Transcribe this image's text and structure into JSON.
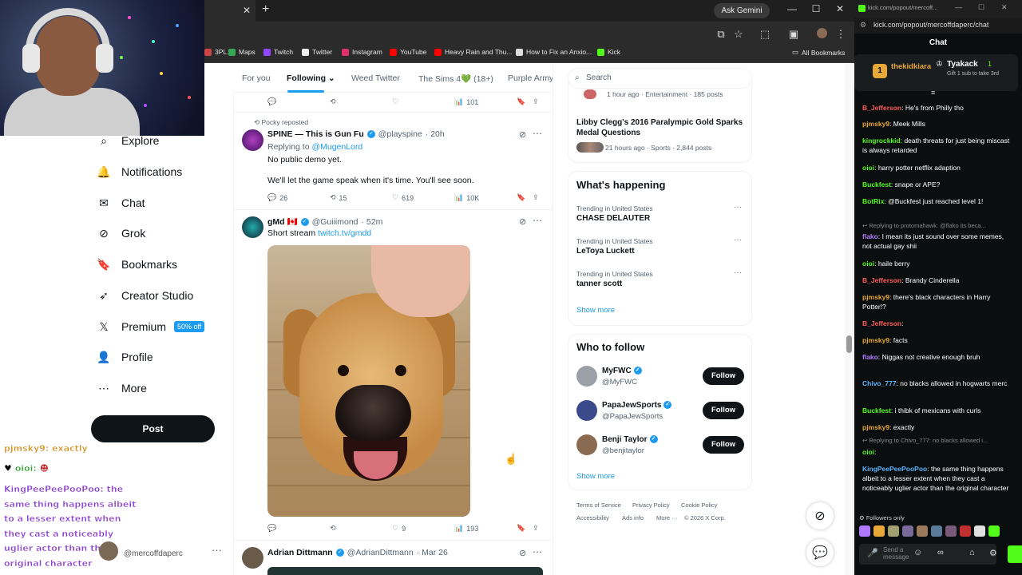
{
  "browser": {
    "tab_close": "✕",
    "new_tab": "+",
    "gemini_label": "Ask Gemini",
    "bookmarks": [
      {
        "label": "3PL...",
        "color": "#c44"
      },
      {
        "label": "Maps",
        "color": "#34a853"
      },
      {
        "label": "Twitch",
        "color": "#9146ff"
      },
      {
        "label": "Twitter",
        "color": "#eee"
      },
      {
        "label": "Instagram",
        "color": "#e1306c"
      },
      {
        "label": "YouTube",
        "color": "#ff0000"
      },
      {
        "label": "Heavy Rain and Thu...",
        "color": "#ff0000"
      },
      {
        "label": "How to Fix an Anxio...",
        "color": "#ddd"
      },
      {
        "label": "Kick",
        "color": "#53fc18"
      }
    ],
    "all_bookmarks": "All Bookmarks"
  },
  "nav": {
    "items": [
      {
        "label": "Explore",
        "icon": "search-icon",
        "glyph": "⌕"
      },
      {
        "label": "Notifications",
        "icon": "bell-icon",
        "glyph": "🔔"
      },
      {
        "label": "Chat",
        "icon": "mail-icon",
        "glyph": "✉"
      },
      {
        "label": "Grok",
        "icon": "grok-icon",
        "glyph": "⊘"
      },
      {
        "label": "Bookmarks",
        "icon": "bookmark-icon",
        "glyph": "🔖"
      },
      {
        "label": "Creator Studio",
        "icon": "rocket-icon",
        "glyph": "➶"
      },
      {
        "label": "Premium",
        "icon": "x-logo-icon",
        "glyph": "𝕏"
      },
      {
        "label": "Profile",
        "icon": "person-icon",
        "glyph": "👤"
      },
      {
        "label": "More",
        "icon": "more-circle-icon",
        "glyph": "⋯"
      }
    ],
    "premium_badge": "50% off",
    "post_button": "Post"
  },
  "overlay_chat": [
    {
      "user": "pjmsky9:",
      "text": " exactly",
      "color": "#d09020"
    },
    {
      "user": "oioi:",
      "text": "",
      "color": "#30a030"
    },
    {
      "user": "KingPeePeePooPoo:",
      "text": " the same thing happens albeit to a lesser extent when they cast a noticeably uglier actor than the original character",
      "color": "#8a40d0"
    }
  ],
  "overlay_user": {
    "handle": "@mercoffdaperc",
    "dots": "···"
  },
  "feed": {
    "tabs": [
      "For you",
      "Following",
      "Weed Twitter",
      "The Sims 4💚 (18+)",
      "Purple Army"
    ],
    "top_actions": {
      "views": "101"
    },
    "tweet1": {
      "repost_label": "Pocky reposted",
      "name": "SPINE — This is Gun Fu",
      "handle": "@playspine",
      "time": "· 20h",
      "replying_prefix": "Replying to",
      "replying_to": "@MugenLord",
      "line1": "No public demo yet.",
      "line2": "We'll let the game speak when it's time. You'll see soon.",
      "replies": "26",
      "reposts": "15",
      "likes": "619",
      "views": "10K"
    },
    "tweet2": {
      "name": "gMd 🇨🇦",
      "handle": "@Guiiimond",
      "time": "· 52m",
      "text_prefix": "Short stream",
      "link": "twitch.tv/gmdd",
      "replies": "",
      "reposts": "",
      "likes": "9",
      "views": "193"
    },
    "tweet3": {
      "name": "Adrian Dittmann",
      "handle": "@AdrianDittmann",
      "time": "· Mar 26"
    }
  },
  "right": {
    "search_placeholder": "Search",
    "news_top": {
      "meta": "1 hour ago · Entertainment · 185 posts"
    },
    "news": {
      "title": "Libby Clegg's 2016 Paralympic Gold Sparks Medal Questions",
      "meta": "21 hours ago · Sports · 2,844 posts"
    },
    "happening_title": "What's happening",
    "trends": [
      {
        "context": "Trending in United States",
        "name": "CHASE DELAUTER"
      },
      {
        "context": "Trending in United States",
        "name": "LeToya Luckett"
      },
      {
        "context": "Trending in United States",
        "name": "tanner scott"
      }
    ],
    "show_more": "Show more",
    "who_title": "Who to follow",
    "follows": [
      {
        "name": "MyFWC",
        "handle": "@MyFWC",
        "avatar_color": "#9aa0a6"
      },
      {
        "name": "PapaJewSports",
        "handle": "@PapaJewSports",
        "avatar_color": "#3b4a8a"
      },
      {
        "name": "Benji Taylor",
        "handle": "@benjitaylor",
        "avatar_color": "#8a6a50"
      }
    ],
    "follow_label": "Follow",
    "footer": [
      "Terms of Service",
      "Privacy Policy",
      "Cookie Policy",
      "Accessibility",
      "Ads info",
      "More ···",
      "© 2026 X Corp."
    ]
  },
  "kick": {
    "tab_url": "kick.com/popout/mercoff...",
    "address": "kick.com/popout/mercoffdaperc/chat",
    "chat_title": "Chat",
    "pinned": {
      "user": "thekidkiara",
      "second_user": "Tyakack",
      "gift_text": "Gift 1 sub to take 3rd",
      "rank1": "1",
      "rank2": "1"
    },
    "messages": [
      {
        "user": "B_Jefferson",
        "text": ": He's from Philly tho",
        "color": "#ff5a5a"
      },
      {
        "user": "pjmsky9",
        "text": ": Meek Mills",
        "color": "#e8a838"
      },
      {
        "user": "kingrockkid",
        "text": ": death threats for just being miscast is always retarded",
        "color": "#53fc18"
      },
      {
        "user": "oioi",
        "text": ": harry potter netflix adaption",
        "color": "#53fc18"
      },
      {
        "user": "Buckfest",
        "text": ": snape or APE?",
        "color": "#53fc18"
      },
      {
        "user": "BotRix",
        "text": ": @Buckfest just reached level 1!",
        "color": "#53fc18"
      },
      {
        "user": "flako",
        "text": ": I mean its just sound over some memes, not actual gay shii",
        "color": "#b07aff"
      },
      {
        "user": "oioi",
        "text": ": haile berry",
        "color": "#53fc18"
      },
      {
        "user": "B_Jefferson",
        "text": ": Brandy Cinderella",
        "color": "#ff5a5a"
      },
      {
        "user": "pjmsky9",
        "text": ": there's black characters in Harry Potter!?",
        "color": "#e8a838"
      },
      {
        "user": "B_Jefferson",
        "text": ":",
        "color": "#ff5a5a"
      },
      {
        "user": "pjmsky9",
        "text": ": facts",
        "color": "#e8a838"
      },
      {
        "user": "flako",
        "text": ": Niggas not creative enough bruh",
        "color": "#b07aff"
      },
      {
        "user": "Chivo_777",
        "text": ": no blacks allowed in hogwarts merc",
        "color": "#5ab4ff"
      },
      {
        "user": "Buckfest",
        "text": ": i thibk of mexicans with curls",
        "color": "#53fc18"
      },
      {
        "user": "pjmsky9",
        "text": ": exactly",
        "color": "#e8a838"
      },
      {
        "user": "oioi",
        "text": ":",
        "color": "#53fc18"
      },
      {
        "user": "KingPeePeePooPoo",
        "text": ": the same thing happens albeit to a lesser extent when they cast a noticeably uglier actor than the original character",
        "color": "#5ab4ff"
      }
    ],
    "reply1": "Replying to protomahawk: @flako its beca...",
    "reply2": "Replying to Chivo_777: no blacks allowed i...",
    "followers_only": "Followers only",
    "send_placeholder": "Send a message"
  }
}
